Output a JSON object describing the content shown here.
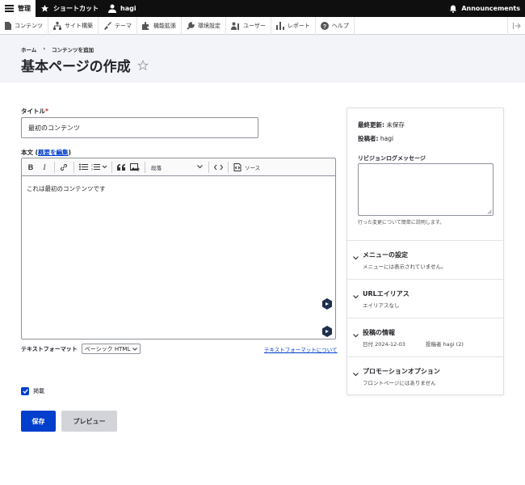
{
  "topbar": {
    "manage": "管理",
    "shortcuts": "ショートカット",
    "user": "hagi",
    "announcements": "Announcements"
  },
  "tray": {
    "items": [
      "コンテンツ",
      "サイト構築",
      "テーマ",
      "機能拡張",
      "環境設定",
      "ユーザー",
      "レポート",
      "ヘルプ"
    ]
  },
  "header": {
    "breadcrumb": [
      "ホーム",
      "コンテンツを追加"
    ],
    "breadcrumb_sep": "›",
    "title": "基本ページの作成"
  },
  "form": {
    "title_label": "タイトル",
    "required_mark": "*",
    "title_value": "最初のコンテンツ",
    "body_label": "本文",
    "summary_link": "概要を編集",
    "editor": {
      "bold": "B",
      "italic": "I",
      "heading_select": "段落",
      "source_label": "ソース",
      "content": "これは最初のコンテンツです"
    },
    "format_label": "テキストフォーマット",
    "format_value": "ベーシック HTML",
    "format_help_link": "テキストフォーマットについて",
    "published_label": "掲載",
    "save_label": "保存",
    "preview_label": "プレビュー"
  },
  "sidebar": {
    "last_saved_label": "最終更新:",
    "last_saved_value": "未保存",
    "author_label": "投稿者:",
    "author_value": "hagi",
    "revision_label": "リビジョンログメッセージ",
    "revision_help": "行った変更について簡単に説明します。",
    "sections": [
      {
        "title": "メニューの設定",
        "summary": "メニューには表示されていません。"
      },
      {
        "title": "URLエイリアス",
        "summary": "エイリアスなし"
      },
      {
        "title": "投稿の情報",
        "summary": "日付 2024-12-03",
        "summary2": "投稿者 hagi (2)"
      },
      {
        "title": "プロモーションオプション",
        "summary": "フロントページにはありません"
      }
    ]
  },
  "colors": {
    "primary": "#003ecc",
    "topbar": "#0f0f0f",
    "header_bg": "#f3f4f9"
  }
}
